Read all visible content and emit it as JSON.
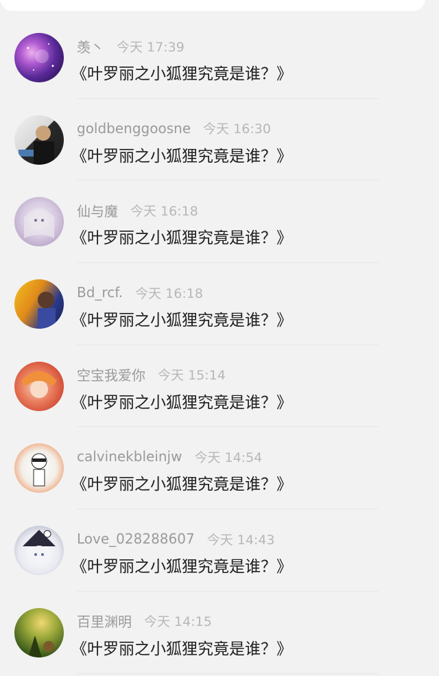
{
  "comments": [
    {
      "name": "羡丶",
      "time": "今天 17:39",
      "text": "《叶罗丽之小狐狸究竟是谁？》",
      "avatar_colors": [
        "#6a2a8a",
        "#d87ad8",
        "#3a1a6a"
      ]
    },
    {
      "name": "goldbenggoosne",
      "time": "今天 16:30",
      "text": "《叶罗丽之小狐狸究竟是谁？》",
      "avatar_colors": [
        "#e8e8e8",
        "#1a1a1a",
        "#c9a27a"
      ]
    },
    {
      "name": "仙与魔",
      "time": "今天 16:18",
      "text": "《叶罗丽之小狐狸究竟是谁？》",
      "avatar_colors": [
        "#d8d0e0",
        "#b8a8c8",
        "#f2eef4"
      ]
    },
    {
      "name": "Bd_rcf.",
      "time": "今天 16:18",
      "text": "《叶罗丽之小狐狸究竟是谁？》",
      "avatar_colors": [
        "#f0c020",
        "#2a3a8a",
        "#e07a1a"
      ]
    },
    {
      "name": "空宝我爱你",
      "time": "今天 15:14",
      "text": "《叶罗丽之小狐狸究竟是谁？》",
      "avatar_colors": [
        "#e84a3a",
        "#f2c0a0",
        "#c0281a"
      ]
    },
    {
      "name": "calvinekbleinjw",
      "time": "今天 14:54",
      "text": "《叶罗丽之小狐狸究竟是谁？》",
      "avatar_colors": [
        "#f06a2a",
        "#ffffff",
        "#2a2a2a"
      ]
    },
    {
      "name": "Love_028288607",
      "time": "今天 14:43",
      "text": "《叶罗丽之小狐狸究竟是谁？》",
      "avatar_colors": [
        "#ffffff",
        "#2a2a3a",
        "#9aa0b8"
      ]
    },
    {
      "name": "百里渊明",
      "time": "今天 14:15",
      "text": "《叶罗丽之小狐狸究竟是谁？》",
      "avatar_colors": [
        "#3a5a1a",
        "#d8b84a",
        "#7a9a2a"
      ]
    }
  ]
}
